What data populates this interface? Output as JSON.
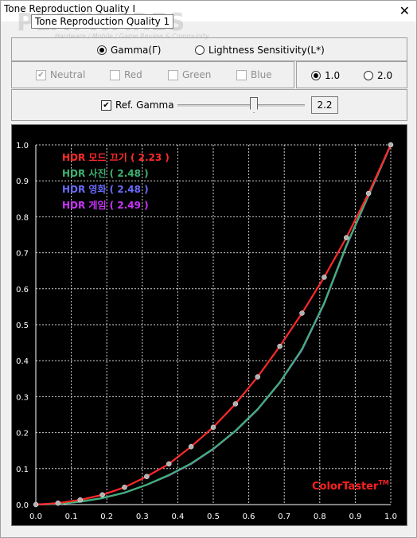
{
  "window": {
    "title": "Tone Reproduction Quality I",
    "tooltip": "Tone Reproduction Quality 1",
    "close_label": "✕"
  },
  "watermark": {
    "main": "PLAYWARES",
    "sub": "Hardware / Mobile / Game Review & Community"
  },
  "mode": {
    "gamma_label": "Gamma(Γ)",
    "gamma_selected": true,
    "lightness_label": "Lightness Sensitivity(L*)",
    "lightness_selected": false
  },
  "channels": {
    "neutral": {
      "label": "Neutral",
      "checked": true
    },
    "red": {
      "label": "Red",
      "checked": false
    },
    "green": {
      "label": "Green",
      "checked": false
    },
    "blue": {
      "label": "Blue",
      "checked": false
    }
  },
  "scale": {
    "opt1": {
      "label": "1.0",
      "selected": true
    },
    "opt2": {
      "label": "2.0",
      "selected": false
    }
  },
  "ref_gamma": {
    "label": "Ref. Gamma",
    "checked": true,
    "value": "2.2",
    "slider_fraction": 0.57
  },
  "brand": {
    "name": "ColorTaster",
    "tm": "TM"
  },
  "chart_data": {
    "type": "line",
    "xlim": [
      0,
      1
    ],
    "ylim": [
      0,
      1
    ],
    "grid": true,
    "legend_position": "top-left",
    "x_ticks": [
      "0.0",
      "0.1",
      "0.2",
      "0.3",
      "0.4",
      "0.5",
      "0.6",
      "0.7",
      "0.8",
      "0.9",
      "1.0"
    ],
    "y_ticks": [
      "0.0",
      "0.1",
      "0.2",
      "0.3",
      "0.4",
      "0.5",
      "0.6",
      "0.7",
      "0.8",
      "0.9",
      "1.0"
    ],
    "series": [
      {
        "name": "HDR 모드 끄기 ( 2.23 )",
        "color": "#ff2a2a",
        "x": [
          0,
          0.0625,
          0.125,
          0.1875,
          0.25,
          0.3125,
          0.375,
          0.4375,
          0.5,
          0.5625,
          0.625,
          0.6875,
          0.75,
          0.8125,
          0.875,
          0.9375,
          1
        ],
        "y": [
          0,
          0.004,
          0.013,
          0.027,
          0.048,
          0.078,
          0.113,
          0.161,
          0.215,
          0.28,
          0.355,
          0.44,
          0.532,
          0.632,
          0.742,
          0.865,
          1
        ]
      },
      {
        "name": "HDR 사진 ( 2.48 )",
        "color": "#3cb371",
        "x": [
          0,
          0.0625,
          0.125,
          0.1875,
          0.25,
          0.3125,
          0.375,
          0.4375,
          0.5,
          0.5625,
          0.625,
          0.6875,
          0.75,
          0.8125,
          0.875,
          0.9375,
          1
        ],
        "y": [
          0,
          0.002,
          0.008,
          0.018,
          0.033,
          0.055,
          0.082,
          0.114,
          0.155,
          0.205,
          0.265,
          0.34,
          0.432,
          0.56,
          0.72,
          0.86,
          1
        ]
      },
      {
        "name": "HDR 영화 ( 2.48 )",
        "color": "#6a6aff",
        "x": [
          0,
          0.0625,
          0.125,
          0.1875,
          0.25,
          0.3125,
          0.375,
          0.4375,
          0.5,
          0.5625,
          0.625,
          0.6875,
          0.75,
          0.8125,
          0.875,
          0.9375,
          1
        ],
        "y": [
          0,
          0.002,
          0.008,
          0.018,
          0.033,
          0.055,
          0.082,
          0.114,
          0.155,
          0.205,
          0.265,
          0.34,
          0.432,
          0.56,
          0.72,
          0.86,
          1
        ]
      },
      {
        "name": "HDR 게임 ( 2.49 )",
        "color": "#cc33ff",
        "x": [
          0,
          0.0625,
          0.125,
          0.1875,
          0.25,
          0.3125,
          0.375,
          0.4375,
          0.5,
          0.5625,
          0.625,
          0.6875,
          0.75,
          0.8125,
          0.875,
          0.9375,
          1
        ],
        "y": [
          0,
          0.002,
          0.008,
          0.018,
          0.033,
          0.055,
          0.081,
          0.113,
          0.154,
          0.204,
          0.264,
          0.339,
          0.43,
          0.558,
          0.718,
          0.859,
          1
        ]
      }
    ]
  }
}
